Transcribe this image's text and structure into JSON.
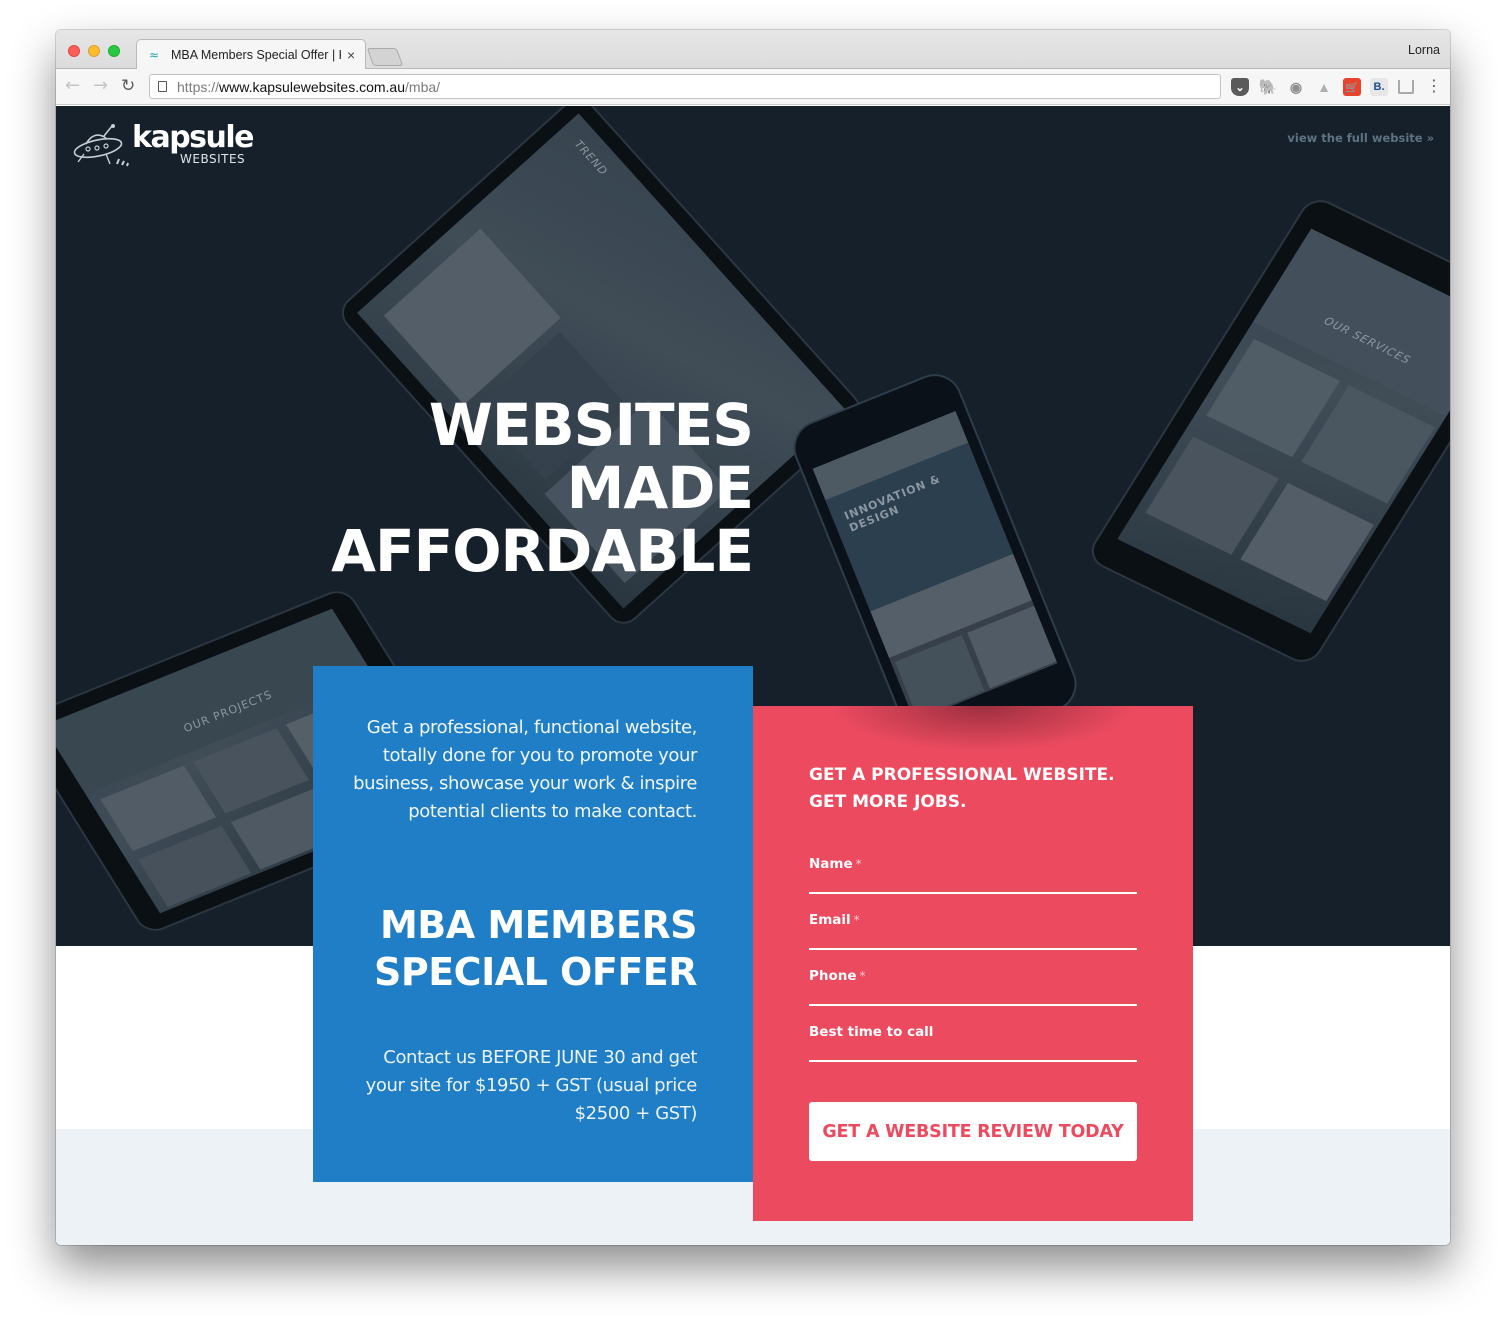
{
  "browser": {
    "tab_title": "MBA Members Special Offer | Kapsule Websites",
    "tab_favicon": "turtle-icon",
    "profile_name": "Lorna",
    "url_scheme": "https://",
    "url_host": "www.kapsulewebsites.com.au",
    "url_path": "/mba/",
    "extensions": [
      "pocket-icon",
      "evernote-icon",
      "camera-icon",
      "drive-icon",
      "shopping-cart-icon",
      "booking-icon",
      "inbox-icon"
    ],
    "icons": {
      "back": "←",
      "forward": "→",
      "reload": "↻",
      "close": "×",
      "menu": "⋮",
      "favicon": "≈",
      "pocket": "⌄",
      "evernote": "🐘",
      "camera": "◉",
      "drive": "▲",
      "cart": "🛒",
      "booking": "B.",
      "inbox": ""
    }
  },
  "page": {
    "logo": {
      "wordmark": "kapsule",
      "sub": "WEBSITES"
    },
    "full_site_link": "view the full website »",
    "headline": [
      "WEBSITES",
      "MADE",
      "AFFORDABLE"
    ],
    "device_screens": {
      "laptop": "TREND",
      "phone": "INNOVATION & DESIGN",
      "tablet_right": "OUR SERVICES",
      "tablet_left": "OUR PROJECTS"
    },
    "offer_panel": {
      "intro": "Get a professional, functional website, totally done for you to promote your business, showcase your work & inspire potential clients to make contact.",
      "title_line1": "MBA MEMBERS",
      "title_line2": "SPECIAL OFFER",
      "offer_text": "Contact us BEFORE JUNE 30 and get your site for $1950 + GST (usual price $2500 + GST)"
    },
    "form": {
      "heading_line1": "GET A PROFESSIONAL WEBSITE.",
      "heading_line2": "GET MORE JOBS.",
      "fields": [
        {
          "label": "Name",
          "required": true,
          "value": ""
        },
        {
          "label": "Email",
          "required": true,
          "value": ""
        },
        {
          "label": "Phone",
          "required": true,
          "value": ""
        },
        {
          "label": "Best time to call",
          "required": false,
          "value": ""
        }
      ],
      "required_marker": "*",
      "submit_label": "GET A WEBSITE REVIEW TODAY"
    },
    "colors": {
      "hero_bg": "#16202a",
      "offer_blue": "#1f7ec5",
      "form_red": "#eb4a5f",
      "footer_band": "#edf2f7",
      "link_muted": "#5d7384"
    }
  }
}
